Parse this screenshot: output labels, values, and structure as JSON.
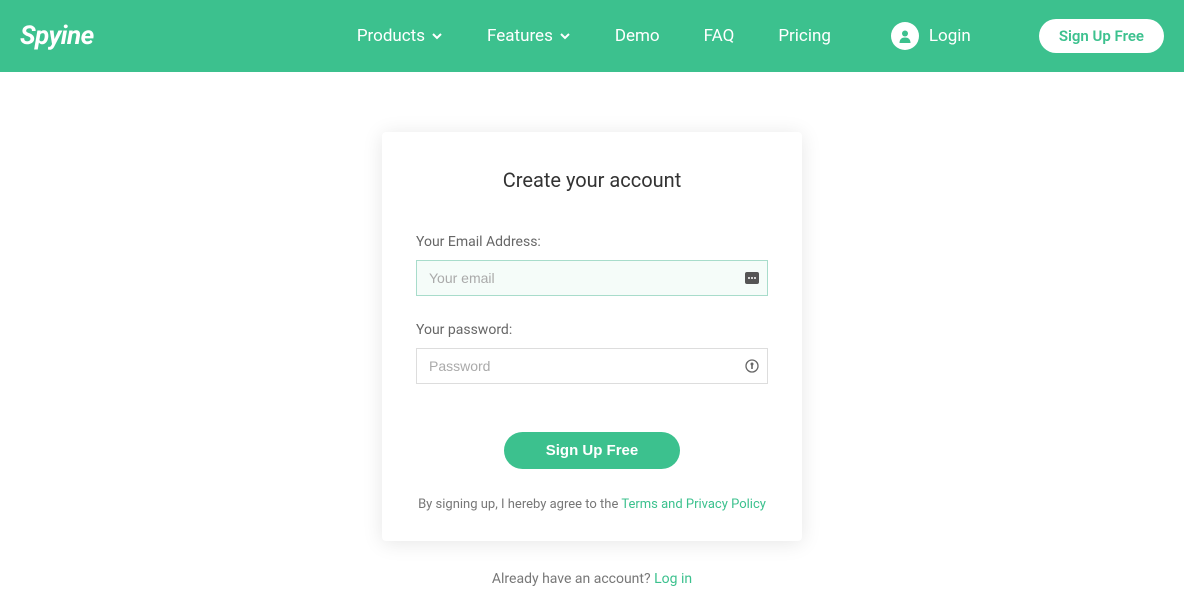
{
  "brand": {
    "name": "Spyine"
  },
  "nav": {
    "products": "Products",
    "features": "Features",
    "demo": "Demo",
    "faq": "FAQ",
    "pricing": "Pricing",
    "login": "Login",
    "signup": "Sign Up Free"
  },
  "card": {
    "title": "Create your account",
    "email_label": "Your Email Address:",
    "email_placeholder": "Your email",
    "password_label": "Your password:",
    "password_placeholder": "Password",
    "submit": "Sign Up Free",
    "terms_prefix": "By signing up, I hereby agree to the ",
    "terms_link": "Terms and Privacy Policy"
  },
  "footer": {
    "already_text": "Already have an account? ",
    "login_link": "Log in"
  },
  "colors": {
    "accent": "#3cc18e"
  }
}
